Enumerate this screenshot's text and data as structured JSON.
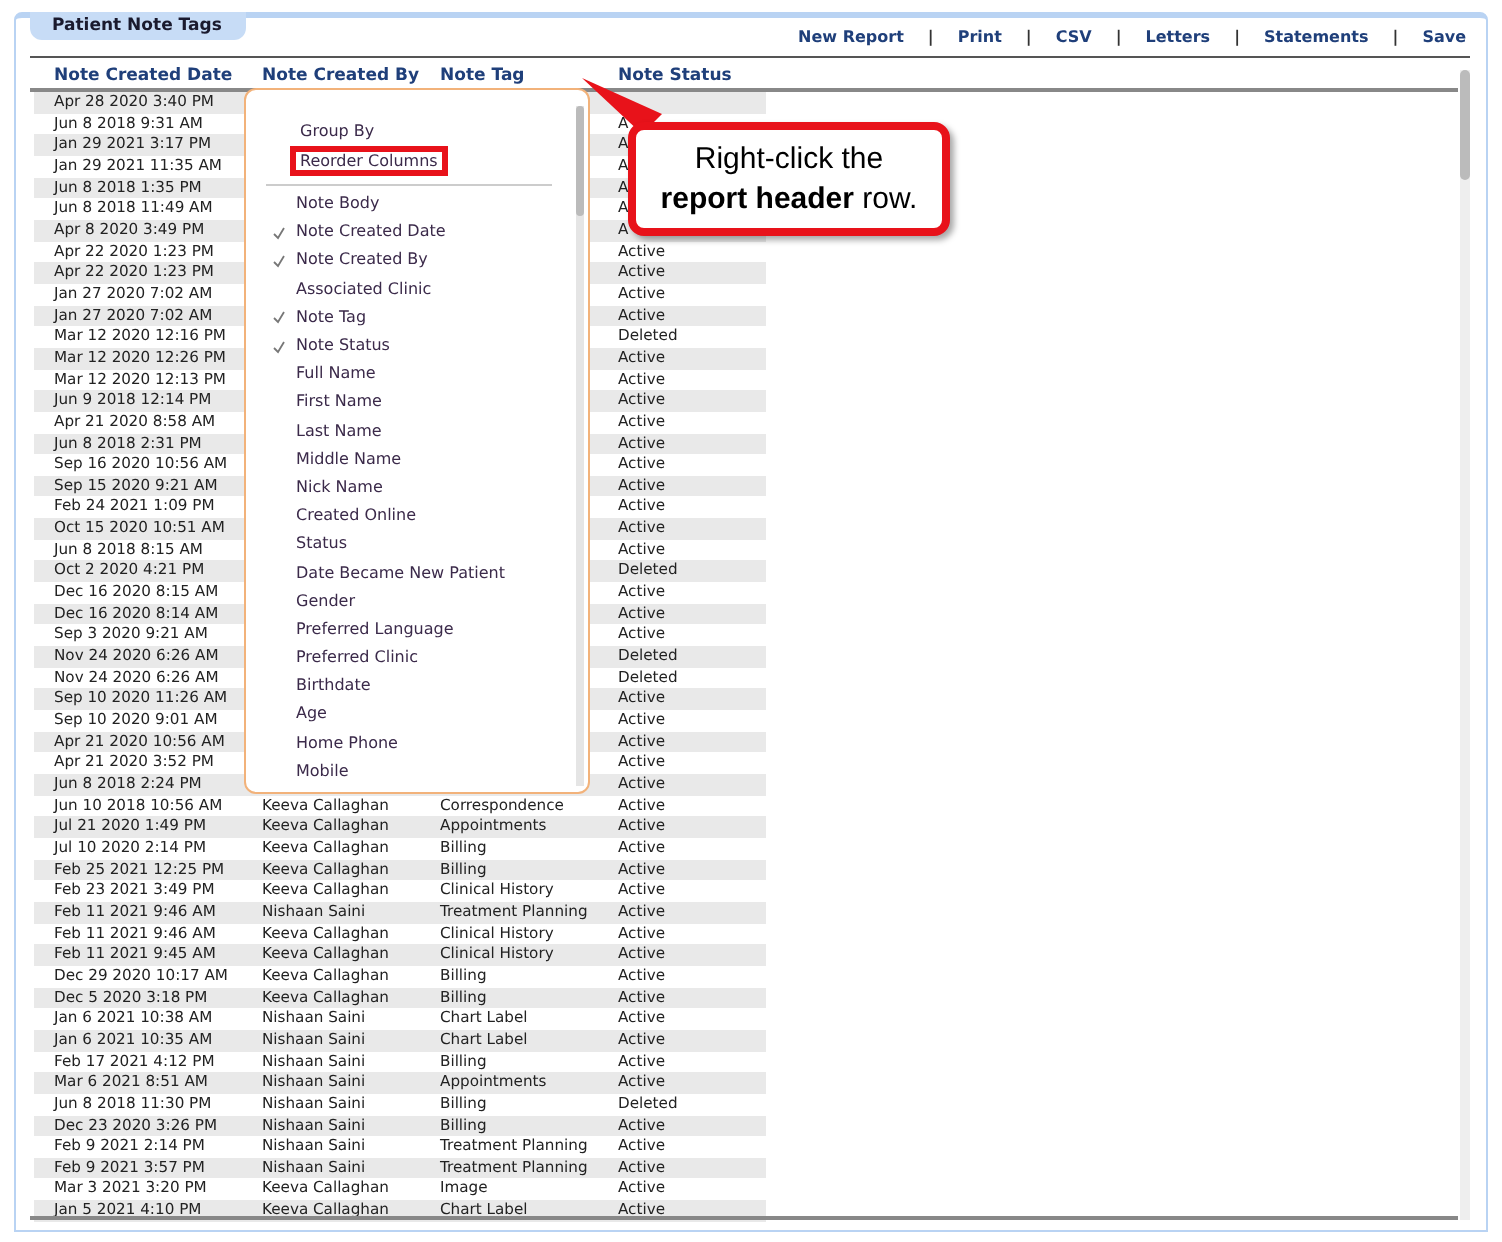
{
  "header_tab": "Patient Note Tags",
  "actions": [
    {
      "kind": "link",
      "label": "New Report"
    },
    {
      "kind": "separator",
      "label": "|"
    },
    {
      "kind": "link",
      "label": "Print"
    },
    {
      "kind": "separator",
      "label": "|"
    },
    {
      "kind": "link",
      "label": "CSV"
    },
    {
      "kind": "separator",
      "label": "|"
    },
    {
      "kind": "link",
      "label": "Letters"
    },
    {
      "kind": "separator",
      "label": "|"
    },
    {
      "kind": "link",
      "label": "Statements"
    },
    {
      "kind": "separator",
      "label": "|"
    },
    {
      "kind": "link",
      "label": "Save"
    }
  ],
  "columns": [
    "Note Created Date",
    "Note Created By",
    "Note Tag",
    "Note Status"
  ],
  "rows": [
    {
      "date": "Apr 28 2020 3:40 PM"
    },
    {
      "date": "Jun 8 2018 9:31 AM",
      "status": "A"
    },
    {
      "date": "Jan 29 2021 3:17 PM",
      "status": "A"
    },
    {
      "date": "Jan 29 2021 11:35 AM",
      "status": "A"
    },
    {
      "date": "Jun 8 2018 1:35 PM",
      "status": "A"
    },
    {
      "date": "Jun 8 2018 11:49 AM",
      "status": "A"
    },
    {
      "date": "Apr 8 2020 3:49 PM",
      "status": "A"
    },
    {
      "date": "Apr 22 2020 1:23 PM",
      "status": "Active"
    },
    {
      "date": "Apr 22 2020 1:23 PM",
      "status": "Active"
    },
    {
      "date": "Jan 27 2020 7:02 AM",
      "status": "Active"
    },
    {
      "date": "Jan 27 2020 7:02 AM",
      "status": "Active"
    },
    {
      "date": "Mar 12 2020 12:16 PM",
      "status": "Deleted"
    },
    {
      "date": "Mar 12 2020 12:26 PM",
      "status": "Active"
    },
    {
      "date": "Mar 12 2020 12:13 PM",
      "status": "Active"
    },
    {
      "date": "Jun 9 2018 12:14 PM",
      "status": "Active"
    },
    {
      "date": "Apr 21 2020 8:58 AM",
      "status": "Active"
    },
    {
      "date": "Jun 8 2018 2:31 PM",
      "status": "Active"
    },
    {
      "date": "Sep 16 2020 10:56 AM",
      "status": "Active"
    },
    {
      "date": "Sep 15 2020 9:21 AM",
      "status": "Active"
    },
    {
      "date": "Feb 24 2021 1:09 PM",
      "status": "Active"
    },
    {
      "date": "Oct 15 2020 10:51 AM",
      "status": "Active"
    },
    {
      "date": "Jun 8 2018 8:15 AM",
      "status": "Active"
    },
    {
      "date": "Oct 2 2020 4:21 PM",
      "status": "Deleted"
    },
    {
      "date": "Dec 16 2020 8:15 AM",
      "status": "Active"
    },
    {
      "date": "Dec 16 2020 8:14 AM",
      "status": "Active"
    },
    {
      "date": "Sep 3 2020 9:21 AM",
      "status": "Active"
    },
    {
      "date": "Nov 24 2020 6:26 AM",
      "status": "Deleted"
    },
    {
      "date": "Nov 24 2020 6:26 AM",
      "status": "Deleted"
    },
    {
      "date": "Sep 10 2020 11:26 AM",
      "status": "Active"
    },
    {
      "date": "Sep 10 2020 9:01 AM",
      "status": "Active"
    },
    {
      "date": "Apr 21 2020 10:56 AM",
      "status": "Active"
    },
    {
      "date": "Apr 21 2020 3:52 PM",
      "status": "Active"
    },
    {
      "date": "Jun 8 2018 2:24 PM",
      "status": "Active"
    },
    {
      "date": "Jun 10 2018 10:56 AM",
      "created_by": "Keeva Callaghan",
      "tag": "Correspondence",
      "status": "Active"
    },
    {
      "date": "Jul 21 2020 1:49 PM",
      "created_by": "Keeva Callaghan",
      "tag": "Appointments",
      "status": "Active"
    },
    {
      "date": "Jul 10 2020 2:14 PM",
      "created_by": "Keeva Callaghan",
      "tag": "Billing",
      "status": "Active"
    },
    {
      "date": "Feb 25 2021 12:25 PM",
      "created_by": "Keeva Callaghan",
      "tag": "Billing",
      "status": "Active"
    },
    {
      "date": "Feb 23 2021 3:49 PM",
      "created_by": "Keeva Callaghan",
      "tag": "Clinical History",
      "status": "Active"
    },
    {
      "date": "Feb 11 2021 9:46 AM",
      "created_by": "Nishaan Saini",
      "tag": "Treatment Planning",
      "status": "Active"
    },
    {
      "date": "Feb 11 2021 9:46 AM",
      "created_by": "Keeva Callaghan",
      "tag": "Clinical History",
      "status": "Active"
    },
    {
      "date": "Feb 11 2021 9:45 AM",
      "created_by": "Keeva Callaghan",
      "tag": "Clinical History",
      "status": "Active"
    },
    {
      "date": "Dec 29 2020 10:17 AM",
      "created_by": "Keeva Callaghan",
      "tag": "Billing",
      "status": "Active"
    },
    {
      "date": "Dec 5 2020 3:18 PM",
      "created_by": "Keeva Callaghan",
      "tag": "Billing",
      "status": "Active"
    },
    {
      "date": "Jan 6 2021 10:38 AM",
      "created_by": "Nishaan Saini",
      "tag": "Chart Label",
      "status": "Active"
    },
    {
      "date": "Jan 6 2021 10:35 AM",
      "created_by": "Nishaan Saini",
      "tag": "Chart Label",
      "status": "Active"
    },
    {
      "date": "Feb 17 2021 4:12 PM",
      "created_by": "Nishaan Saini",
      "tag": "Billing",
      "status": "Active"
    },
    {
      "date": "Mar 6 2021 8:51 AM",
      "created_by": "Nishaan Saini",
      "tag": "Appointments",
      "status": "Active"
    },
    {
      "date": "Jun 8 2018 11:30 PM",
      "created_by": "Nishaan Saini",
      "tag": "Billing",
      "status": "Deleted"
    },
    {
      "date": "Dec 23 2020 3:26 PM",
      "created_by": "Nishaan Saini",
      "tag": "Billing",
      "status": "Active"
    },
    {
      "date": "Feb 9 2021 2:14 PM",
      "created_by": "Nishaan Saini",
      "tag": "Treatment Planning",
      "status": "Active"
    },
    {
      "date": "Feb 9 2021 3:57 PM",
      "created_by": "Nishaan Saini",
      "tag": "Treatment Planning",
      "status": "Active"
    },
    {
      "date": "Mar 3 2021 3:20 PM",
      "created_by": "Keeva Callaghan",
      "tag": "Image",
      "status": "Active"
    },
    {
      "date": "Jan 5 2021 4:10 PM",
      "created_by": "Keeva Callaghan",
      "tag": "Chart Label",
      "status": "Active"
    }
  ],
  "column_menu": {
    "top_items": [
      {
        "label": "Group By",
        "highlighted": false
      },
      {
        "label": "Reorder Columns",
        "highlighted": true
      }
    ],
    "columns": [
      {
        "label": "Note Body",
        "checked": false
      },
      {
        "label": "Note Created Date",
        "checked": true
      },
      {
        "label": "Note Created By",
        "checked": true
      },
      {
        "label": "Associated Clinic",
        "checked": false
      },
      {
        "label": "Note Tag",
        "checked": true
      },
      {
        "label": "Note Status",
        "checked": true
      },
      {
        "label": "Full Name",
        "checked": false
      },
      {
        "label": "First Name",
        "checked": false
      },
      {
        "label": "Last Name",
        "checked": false
      },
      {
        "label": "Middle Name",
        "checked": false
      },
      {
        "label": "Nick Name",
        "checked": false
      },
      {
        "label": "Created Online",
        "checked": false
      },
      {
        "label": "Status",
        "checked": false
      },
      {
        "label": "Date Became New Patient",
        "checked": false
      },
      {
        "label": "Gender",
        "checked": false
      },
      {
        "label": "Preferred Language",
        "checked": false
      },
      {
        "label": "Preferred Clinic",
        "checked": false
      },
      {
        "label": "Birthdate",
        "checked": false
      },
      {
        "label": "Age",
        "checked": false
      },
      {
        "label": "Home Phone",
        "checked": false
      },
      {
        "label": "Mobile",
        "checked": false
      }
    ]
  },
  "callout": {
    "text": "Right-click the **report header** row."
  }
}
